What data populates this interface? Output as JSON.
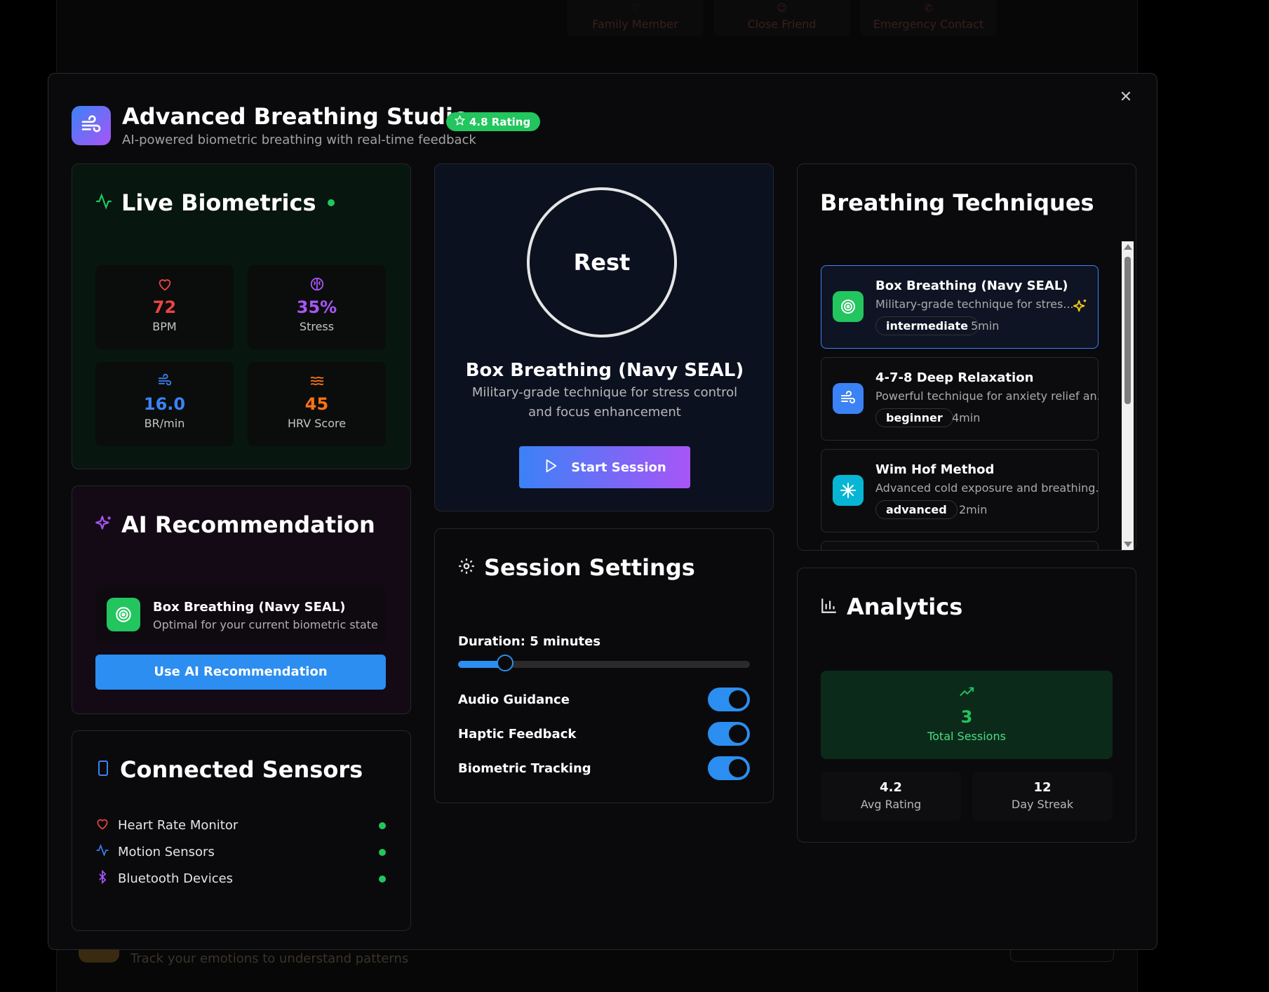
{
  "background": {
    "tabs": [
      "Family Member",
      "Close Friend",
      "Emergency Contact"
    ],
    "bottom_text": "Track your emotions to understand patterns"
  },
  "header": {
    "title": "Advanced Breathing Studio",
    "subtitle": "AI-powered biometric breathing with real-time feedback",
    "rating": "4.8 Rating"
  },
  "biometrics": {
    "title": "Live Biometrics",
    "metrics": [
      {
        "value": "72",
        "label": "BPM",
        "color": "#ef4444",
        "icon": "heart-icon"
      },
      {
        "value": "35%",
        "label": "Stress",
        "color": "#a855f7",
        "icon": "brain-icon"
      },
      {
        "value": "16.0",
        "label": "BR/min",
        "color": "#3b82f6",
        "icon": "wind-icon"
      },
      {
        "value": "45",
        "label": "HRV Score",
        "color": "#f97316",
        "icon": "waves-icon"
      }
    ]
  },
  "ai": {
    "title": "AI Recommendation",
    "rec_name": "Box Breathing (Navy SEAL)",
    "rec_desc": "Optimal for your current biometric state",
    "button": "Use AI Recommendation"
  },
  "sensors": {
    "title": "Connected Sensors",
    "items": [
      {
        "label": "Heart Rate Monitor",
        "icon": "heart-icon"
      },
      {
        "label": "Motion Sensors",
        "icon": "activity-icon"
      },
      {
        "label": "Bluetooth Devices",
        "icon": "bluetooth-icon"
      }
    ]
  },
  "session": {
    "phase": "Rest",
    "technique": "Box Breathing (Navy SEAL)",
    "description": "Military-grade technique for stress control and focus enhancement",
    "start_button": "Start Session"
  },
  "settings": {
    "title": "Session Settings",
    "duration_label": "Duration: 5 minutes",
    "duration_fraction": 0.16,
    "toggles": [
      {
        "label": "Audio Guidance",
        "on": true
      },
      {
        "label": "Haptic Feedback",
        "on": true
      },
      {
        "label": "Biometric Tracking",
        "on": true
      }
    ]
  },
  "techniques": {
    "title": "Breathing Techniques",
    "items": [
      {
        "name": "Box Breathing (Navy SEAL)",
        "desc": "Military-grade technique for stres...",
        "level": "intermediate",
        "duration": "5min",
        "color": "#22c55e",
        "icon": "target-icon",
        "selected": true
      },
      {
        "name": "4-7-8 Deep Relaxation",
        "desc": "Powerful technique for anxiety relief an...",
        "level": "beginner",
        "duration": "4min",
        "color": "#3b82f6",
        "icon": "wind-icon",
        "selected": false
      },
      {
        "name": "Wim Hof Method",
        "desc": "Advanced cold exposure and breathing...",
        "level": "advanced",
        "duration": "2min",
        "color": "#06b6d4",
        "icon": "snowflake-icon",
        "selected": false
      }
    ]
  },
  "analytics": {
    "title": "Analytics",
    "total_value": "3",
    "total_label": "Total Sessions",
    "stats": [
      {
        "value": "4.2",
        "label": "Avg Rating"
      },
      {
        "value": "12",
        "label": "Day Streak"
      }
    ]
  }
}
